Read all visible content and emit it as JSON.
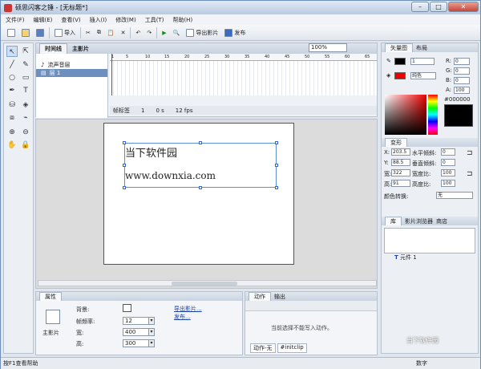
{
  "window": {
    "title": "硕思闪客之锤 - [无标题*]",
    "min": "–",
    "max": "□",
    "close": "✕"
  },
  "menu": [
    "文件(F)",
    "编辑(E)",
    "查看(V)",
    "插入(I)",
    "修改(M)",
    "工具(T)",
    "帮助(H)"
  ],
  "toolbar": {
    "import": "导入",
    "export_movie": "导出影片",
    "publish": "发布"
  },
  "timeline": {
    "tab": "时间线",
    "scene": "主影片",
    "layers": [
      "流声音层",
      "层 1"
    ],
    "ruler": [
      "1",
      "5",
      "10",
      "15",
      "20",
      "25",
      "30",
      "35",
      "40",
      "45",
      "50",
      "55",
      "60",
      "65"
    ],
    "status": {
      "label": "帧标签",
      "frame": "1",
      "time": "0 s",
      "fps": "12 fps"
    }
  },
  "zoom": "100%",
  "stage": {
    "line1": "当下软件园",
    "line2": "www.downxia.com"
  },
  "properties": {
    "tab": "属性",
    "title": "主影片",
    "bg_label": "背景:",
    "fps_label": "帧频率:",
    "fps": "12",
    "width_label": "宽:",
    "width": "400",
    "height_label": "高:",
    "height": "300",
    "export_link": "导出影片...",
    "publish_link": "发布..."
  },
  "actions": {
    "tab1": "动作",
    "tab2": "输出",
    "message": "当前选择不能写入动作。",
    "bottom_tab1": "动作-无",
    "bottom_tab2": "#initclip"
  },
  "right": {
    "tabs": [
      "矢量图",
      "布局"
    ],
    "stroke_width": "1",
    "fill_type": "纯色",
    "rgb": {
      "r": "0",
      "g": "0",
      "b": "0",
      "a": "100"
    },
    "hex": "#000000",
    "transform_tab": "变形",
    "x": "203.5",
    "y": "88.5",
    "w": "322",
    "h": "91",
    "hskew": "0",
    "vskew": "0",
    "wscale": "100",
    "hscale": "100",
    "x_label": "X:",
    "y_label": "Y:",
    "w_label": "宽:",
    "h_label": "高:",
    "hskew_label": "水平倾斜:",
    "vskew_label": "垂直倾斜:",
    "wscale_label": "宽度比:",
    "hscale_label": "高度比:",
    "color_transform_label": "颜色转换:",
    "color_transform": "无",
    "lib_tabs": [
      "库",
      "影片浏览器",
      "商店"
    ],
    "lib_item": "元件 1"
  },
  "status": {
    "help": "按F1查看帮助",
    "mode": "数字"
  },
  "watermark": "当下软件园"
}
